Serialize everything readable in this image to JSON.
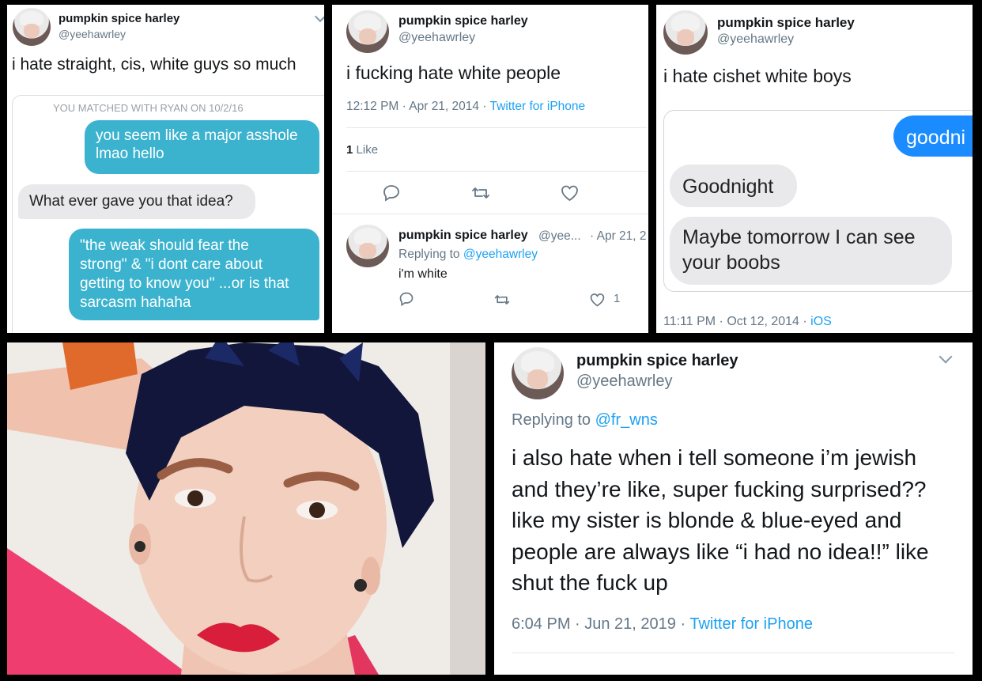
{
  "profile": {
    "name": "pumpkin spice harley",
    "handle": "@yeehawrley"
  },
  "panel1": {
    "tweet": "i hate straight, cis, white guys so much",
    "match_header": "YOU MATCHED WITH RYAN ON 10/2/16",
    "messages": [
      {
        "from": "me",
        "lines": [
          "you seem like a major asshole",
          "lmao hello"
        ]
      },
      {
        "from": "them",
        "lines": [
          "What ever gave you that idea?"
        ]
      },
      {
        "from": "me",
        "lines": [
          "\"the weak should fear the",
          "strong\" & \"i dont care about",
          "getting to know you\" ...or is that",
          "sarcasm hahaha"
        ]
      }
    ]
  },
  "panel2": {
    "tweet": "i fucking hate white people",
    "time": "12:12 PM · Apr 21, 2014 · ",
    "source": "Twitter for iPhone",
    "likes_count": "1",
    "likes_label": "Like",
    "reply": {
      "name": "pumpkin spice harley",
      "handle": "@yee...",
      "date": "· Apr 21, 2",
      "replying_prefix": "Replying to ",
      "replying_to": "@yeehawrley",
      "text": "i'm white",
      "like_count": "1"
    }
  },
  "panel3": {
    "tweet": "i hate cishet white boys",
    "messages": [
      {
        "from": "me",
        "text": "goodni"
      },
      {
        "from": "them",
        "text": "Goodnight"
      },
      {
        "from": "them",
        "lines": [
          "Maybe tomorrow I can see",
          "your boobs"
        ]
      }
    ],
    "time": "11:11 PM · Oct 12, 2014 · ",
    "source": "iOS"
  },
  "panel5": {
    "replying_prefix": "Replying to ",
    "replying_to": "@fr_wns",
    "lines": [
      "i also hate when i tell someone i’m jewish",
      "and they’re like, super fucking surprised??",
      "like my sister is blonde & blue-eyed and",
      "people are always like “i had no idea!!” like",
      "shut the fuck up"
    ],
    "time": "6:04 PM · Jun 21, 2019 · ",
    "source": "Twitter for iPhone"
  },
  "colors": {
    "twitter_blue": "#1da1f2",
    "sent_bubble": "#3bb3cf",
    "received_bubble": "#e9e9eb",
    "outgoing_blue": "#1a8cff"
  }
}
